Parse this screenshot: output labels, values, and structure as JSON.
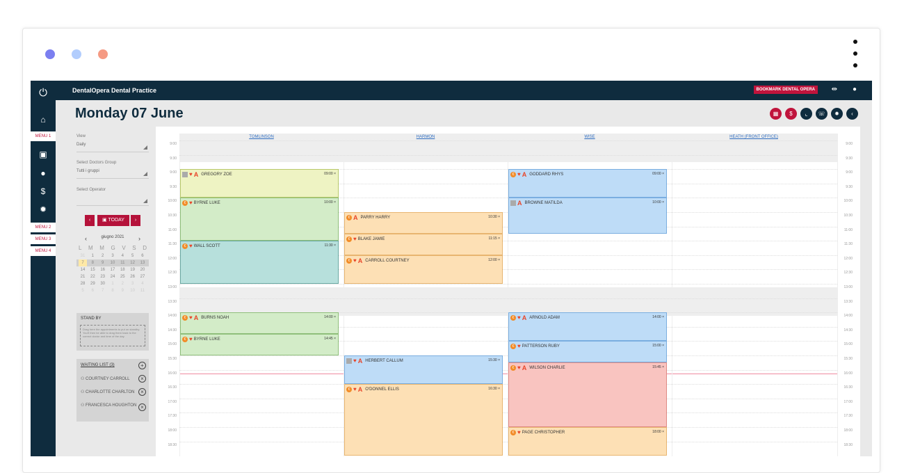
{
  "window": {
    "dots": [
      "#7b7ff0",
      "#b2cdfd",
      "#f59a83"
    ]
  },
  "app": {
    "brand": "DentalOpera Dental Practice",
    "bookmark_label": "BOOKMARK DENTAL OPERA",
    "page_title": "Monday 07 June",
    "menus": [
      "MENU 1",
      "MENU 2",
      "MENU 3",
      "MENU 4"
    ]
  },
  "controls": {
    "view_label": "View",
    "view_value": "Daily",
    "doctors_label": "Select Doctors Group",
    "doctors_value": "Tutti i gruppi",
    "operator_label": "Select Operator",
    "operator_value": "",
    "prev": "‹",
    "today": "TODAY",
    "next": "›"
  },
  "calendar": {
    "month": "giugno 2021",
    "dow": [
      "L",
      "M",
      "M",
      "G",
      "V",
      "S",
      "D"
    ],
    "weeks": [
      [
        "31",
        "1",
        "2",
        "3",
        "4",
        "5",
        "6"
      ],
      [
        "7",
        "8",
        "9",
        "10",
        "11",
        "12",
        "13"
      ],
      [
        "14",
        "15",
        "16",
        "17",
        "18",
        "19",
        "20"
      ],
      [
        "21",
        "22",
        "23",
        "24",
        "25",
        "26",
        "27"
      ],
      [
        "28",
        "29",
        "30",
        "1",
        "2",
        "3",
        "4"
      ],
      [
        "5",
        "6",
        "7",
        "8",
        "9",
        "10",
        "11"
      ]
    ]
  },
  "standby": {
    "title": "STAND BY",
    "hint": "Drag here the appointments to put on standby. You'll then be able to drag them back to the correct doctor and time of the day."
  },
  "waiting": {
    "title": "WAITING LIST (3)",
    "people": [
      "COURTNEY CARROLL",
      "CHARLOTTE CHARLTON",
      "FRANCESCA HOUGHTON"
    ]
  },
  "schedule": {
    "columns": [
      "TOMLINSON",
      "HARMON",
      "WISE",
      "HEATH (FRONT OFFICE)"
    ],
    "times": [
      "9:00",
      "9:30",
      "9:00",
      "9:30",
      "10:00",
      "10:30",
      "11:00",
      "11:30",
      "12:00",
      "12:30",
      "13:00",
      "13:30",
      "14:00",
      "14:30",
      "15:00",
      "15:30",
      "16:00",
      "16:30",
      "17:00",
      "17:30",
      "18:00",
      "18:30"
    ],
    "appointments": [
      {
        "col": 0,
        "slot": 2,
        "len": 2,
        "name": "GREGORY ZOE",
        "time": "09:00",
        "color": "#eef3c3",
        "border": "#b8c86a",
        "icons": [
          "sq",
          "h",
          "a"
        ]
      },
      {
        "col": 0,
        "slot": 4,
        "len": 3,
        "name": "BYRNE LUKE",
        "time": "10:00",
        "color": "#d3ecc8",
        "border": "#8fbf7a",
        "icons": [
          "c",
          "h"
        ]
      },
      {
        "col": 0,
        "slot": 7,
        "len": 3,
        "name": "WALL SCOTT",
        "time": "11:30",
        "color": "#b7e0dc",
        "border": "#6aa9a3",
        "icons": [
          "c",
          "h"
        ]
      },
      {
        "col": 0,
        "slot": 12,
        "len": 1.5,
        "name": "BURNS NOAH",
        "time": "14:00",
        "color": "#d3ecc8",
        "border": "#8fbf7a",
        "icons": [
          "c",
          "h",
          "a"
        ]
      },
      {
        "col": 0,
        "slot": 13.5,
        "len": 1.5,
        "name": "BYRNE LUKE",
        "time": "14:45",
        "color": "#d3ecc8",
        "border": "#8fbf7a",
        "icons": [
          "c",
          "h"
        ]
      },
      {
        "col": 1,
        "slot": 5,
        "len": 1.5,
        "name": "PARRY HARRY",
        "time": "10:30",
        "color": "#fde0b5",
        "border": "#e8b570",
        "icons": [
          "c",
          "a"
        ]
      },
      {
        "col": 1,
        "slot": 6.5,
        "len": 1.5,
        "name": "BLAKE JAMIE",
        "time": "11:15",
        "color": "#fde0b5",
        "border": "#e8b570",
        "icons": [
          "c",
          "h"
        ]
      },
      {
        "col": 1,
        "slot": 8,
        "len": 2,
        "name": "CARROLL COURTNEY",
        "time": "12:00",
        "color": "#fde0b5",
        "border": "#e8b570",
        "icons": [
          "c",
          "h",
          "a"
        ]
      },
      {
        "col": 1,
        "slot": 15,
        "len": 2,
        "name": "HERBERT CALLUM",
        "time": "15:30",
        "color": "#bedcf7",
        "border": "#7aaee0",
        "icons": [
          "sq",
          "h",
          "a"
        ]
      },
      {
        "col": 1,
        "slot": 17,
        "len": 5,
        "name": "O'DONNEL ELLIS",
        "time": "16:30",
        "color": "#fde0b5",
        "border": "#e8b570",
        "icons": [
          "c",
          "h",
          "a"
        ]
      },
      {
        "col": 2,
        "slot": 2,
        "len": 2,
        "name": "GODDARD RHYS",
        "time": "09:00",
        "color": "#bedcf7",
        "border": "#7aaee0",
        "icons": [
          "c",
          "h",
          "a"
        ]
      },
      {
        "col": 2,
        "slot": 4,
        "len": 2.5,
        "name": "BROWNE MATILDA",
        "time": "10:00",
        "color": "#bedcf7",
        "border": "#7aaee0",
        "icons": [
          "sq",
          "a"
        ]
      },
      {
        "col": 2,
        "slot": 12,
        "len": 2,
        "name": "ARNOLD ADAM",
        "time": "14:00",
        "color": "#bedcf7",
        "border": "#7aaee0",
        "icons": [
          "c",
          "h",
          "a"
        ]
      },
      {
        "col": 2,
        "slot": 14,
        "len": 1.5,
        "name": "PATTERSON RUBY",
        "time": "15:00",
        "color": "#bedcf7",
        "border": "#7aaee0",
        "icons": [
          "c",
          "h"
        ]
      },
      {
        "col": 2,
        "slot": 15.5,
        "len": 4.5,
        "name": "WILSON CHARLIE",
        "time": "15:45",
        "color": "#f9c4c0",
        "border": "#df8a84",
        "icons": [
          "c",
          "h",
          "a"
        ]
      },
      {
        "col": 2,
        "slot": 20,
        "len": 2,
        "name": "PAGE CHRISTOPHER",
        "time": "18:00",
        "color": "#fde0b5",
        "border": "#e8b570",
        "icons": [
          "c",
          "h"
        ]
      }
    ]
  }
}
